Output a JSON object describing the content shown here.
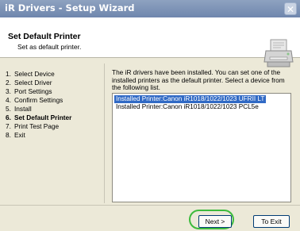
{
  "window": {
    "title": "iR Drivers - Setup Wizard",
    "close_glyph": "✕"
  },
  "header": {
    "title": "Set Default Printer",
    "subtitle": "Set as default printer.",
    "icon": "printer-wizard-icon"
  },
  "steps": [
    {
      "number": "1.",
      "label": "Select Device",
      "active": false
    },
    {
      "number": "2.",
      "label": "Select Driver",
      "active": false
    },
    {
      "number": "3.",
      "label": "Port Settings",
      "active": false
    },
    {
      "number": "4.",
      "label": "Confirm Settings",
      "active": false
    },
    {
      "number": "5.",
      "label": "Install",
      "active": false
    },
    {
      "number": "6.",
      "label": "Set Default Printer",
      "active": true
    },
    {
      "number": "7.",
      "label": "Print Test Page",
      "active": false
    },
    {
      "number": "8.",
      "label": "Exit",
      "active": false
    }
  ],
  "content": {
    "description": "The iR drivers have been installed. You can set one of the installed printers as the default printer. Select a device from the following list.",
    "printers": [
      {
        "label": "Installed Printer:Canon iR1018/1022/1023 UFRII LT",
        "selected": true
      },
      {
        "label": "Installed Printer:Canon iR1018/1022/1023 PCL5e",
        "selected": false
      }
    ]
  },
  "buttons": {
    "next": "Next >",
    "exit": "To Exit"
  },
  "colors": {
    "highlight": "#3dbb3d",
    "selection": "#316ac5"
  }
}
